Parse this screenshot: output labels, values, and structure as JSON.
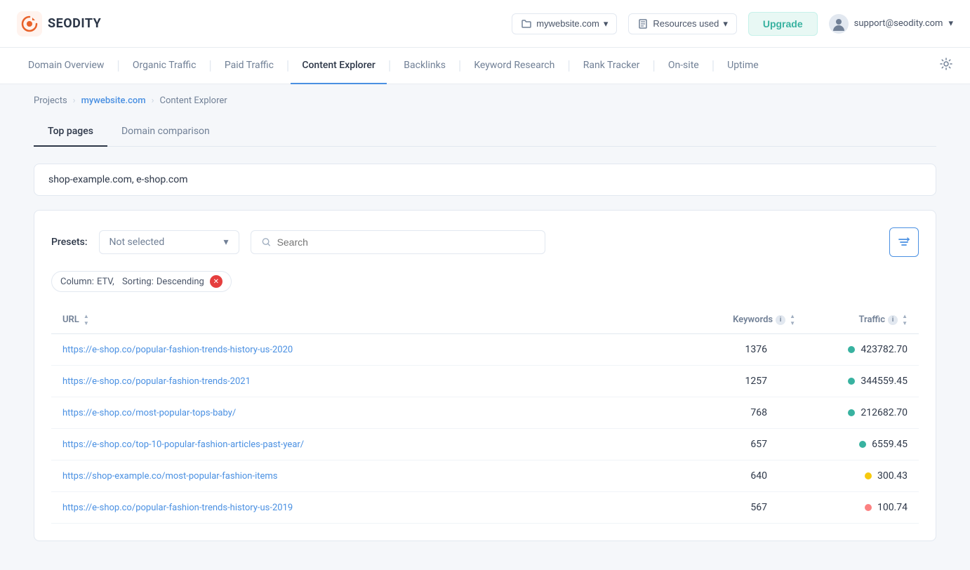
{
  "app": {
    "logo_text": "SEODITY"
  },
  "header": {
    "website": "mywebsite.com",
    "resources_label": "Resources used",
    "upgrade_label": "Upgrade",
    "user_email": "support@seodity.com"
  },
  "nav": {
    "items": [
      {
        "label": "Domain Overview",
        "active": false
      },
      {
        "label": "Organic Traffic",
        "active": false
      },
      {
        "label": "Paid Traffic",
        "active": false
      },
      {
        "label": "Content Explorer",
        "active": true
      },
      {
        "label": "Backlinks",
        "active": false
      },
      {
        "label": "Keyword Research",
        "active": false
      },
      {
        "label": "Rank Tracker",
        "active": false
      },
      {
        "label": "On-site",
        "active": false
      },
      {
        "label": "Uptime",
        "active": false
      }
    ]
  },
  "breadcrumb": {
    "projects": "Projects",
    "website": "mywebsite.com",
    "page": "Content Explorer"
  },
  "tabs": {
    "items": [
      {
        "label": "Top pages",
        "active": true
      },
      {
        "label": "Domain comparison",
        "active": false
      }
    ]
  },
  "domain_input": {
    "domains": "shop-example.com,  e-shop.com"
  },
  "filters": {
    "presets_label": "Presets:",
    "presets_placeholder": "Not selected",
    "search_placeholder": "Search"
  },
  "filter_tags": {
    "column_label": "Column:",
    "column_value": "ETV,",
    "sorting_label": "Sorting:",
    "sorting_value": "Descending"
  },
  "table": {
    "columns": [
      {
        "label": "URL"
      },
      {
        "label": "Keywords"
      },
      {
        "label": "Traffic"
      }
    ],
    "rows": [
      {
        "url": "https://e-shop.co/popular-fashion-trends-history-us-2020",
        "keywords": 1376,
        "traffic": "423782.70",
        "dot": "green"
      },
      {
        "url": "https://e-shop.co/popular-fashion-trends-2021",
        "keywords": 1257,
        "traffic": "344559.45",
        "dot": "green"
      },
      {
        "url": "https://e-shop.co/most-popular-tops-baby/",
        "keywords": 768,
        "traffic": "212682.70",
        "dot": "green"
      },
      {
        "url": "https://e-shop.co/top-10-popular-fashion-articles-past-year/",
        "keywords": 657,
        "traffic": "6559.45",
        "dot": "green"
      },
      {
        "url": "https://shop-example.co/most-popular-fashion-items",
        "keywords": 640,
        "traffic": "300.43",
        "dot": "yellow"
      },
      {
        "url": "https://e-shop.co/popular-fashion-trends-history-us-2019",
        "keywords": 567,
        "traffic": "100.74",
        "dot": "red"
      }
    ]
  }
}
